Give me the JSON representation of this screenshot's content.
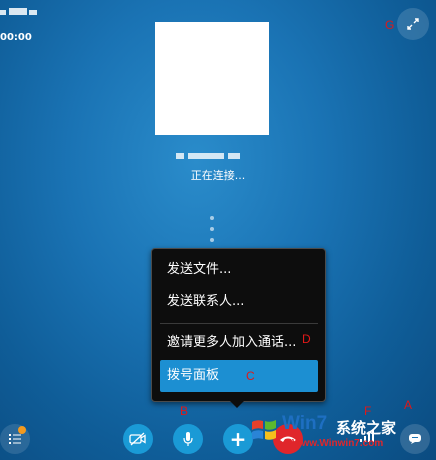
{
  "top_left": {
    "time": "00:00"
  },
  "call": {
    "status": "正在连接..."
  },
  "menu": {
    "items": [
      {
        "label": "发送文件..."
      },
      {
        "label": "发送联系人..."
      },
      {
        "label": "邀请更多人加入通话..."
      },
      {
        "label": "拨号面板"
      }
    ],
    "selected_index": 3
  },
  "annotations": {
    "a": "A",
    "b": "B",
    "c": "C",
    "d": "D",
    "f": "F",
    "g": "G"
  },
  "toolbar": {
    "add_label": "+",
    "video_icon": "video-off-icon",
    "mic_icon": "microphone-icon",
    "end_icon": "phone-hangup-icon",
    "menu_icon": "list-icon",
    "chat_icon": "chat-bubble-icon",
    "signal_icon": "signal-strength-icon",
    "expand_icon": "fullscreen-icon"
  },
  "watermark": {
    "brand": "Win7",
    "suffix": "系统之家",
    "url": "Www.Winwin7.com"
  },
  "colors": {
    "background": "#1a73b4",
    "menu_bg": "#0d0d0d",
    "selected": "#1c8fd2",
    "end_call": "#e0262b",
    "button_blue": "#1a9ad6",
    "annotation": "#e01818",
    "badge": "#f39a1e"
  }
}
